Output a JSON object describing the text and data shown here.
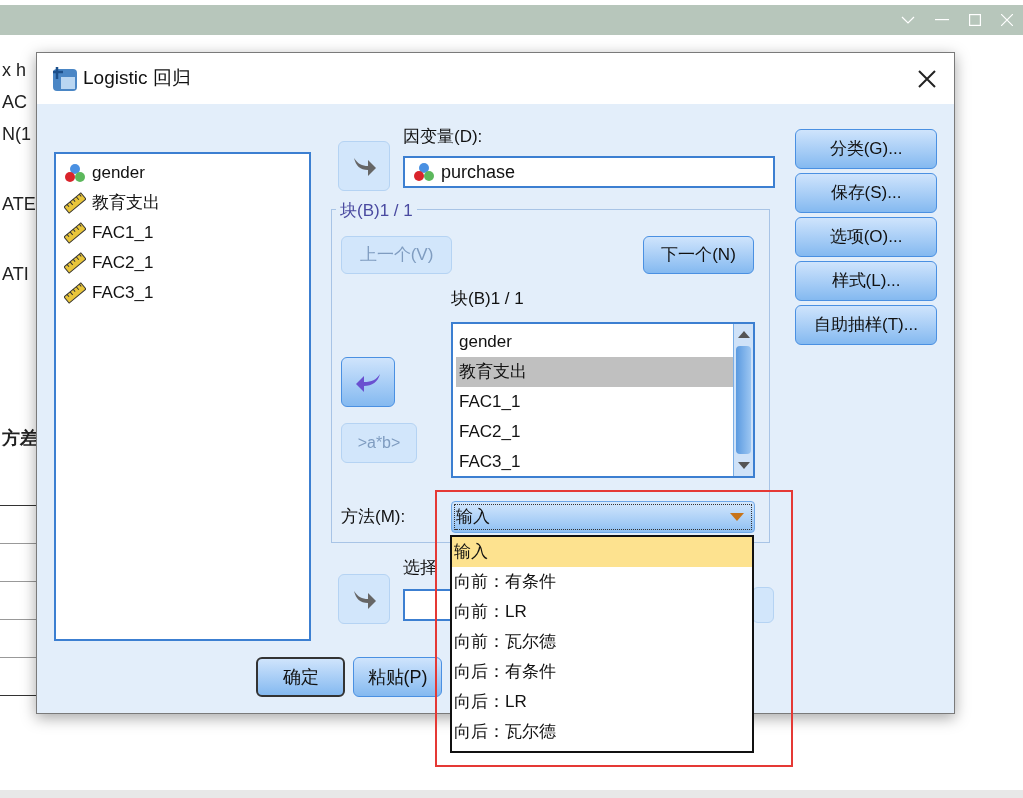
{
  "background_fragments": [
    "x h",
    "AC",
    "N(1",
    "ATE",
    "ATI",
    "方差"
  ],
  "dialog": {
    "title": "Logistic 回归"
  },
  "variables": [
    {
      "name": "gender",
      "kind": "nominal"
    },
    {
      "name": "教育支出",
      "kind": "scale"
    },
    {
      "name": "FAC1_1",
      "kind": "scale"
    },
    {
      "name": "FAC2_1",
      "kind": "scale"
    },
    {
      "name": "FAC3_1",
      "kind": "scale"
    }
  ],
  "dependent": {
    "label": "因变量(D):",
    "value": "purchase",
    "kind": "nominal",
    "arrow": {
      "kind": "add",
      "disabled": true
    }
  },
  "block": {
    "legend": "块(B)1 / 1",
    "previous_button": {
      "label": "上一个(V)",
      "disabled": true
    },
    "next_button": {
      "label": "下一个(N)",
      "disabled": false
    },
    "list_label": "块(B)1 / 1",
    "arrow": {
      "kind": "remove",
      "disabled": false
    },
    "interaction_button": {
      "label": ">a*b>",
      "disabled": true
    },
    "covariates": [
      {
        "name": "gender",
        "selected": false
      },
      {
        "name": "教育支出",
        "selected": true
      },
      {
        "name": "FAC1_1",
        "selected": false
      },
      {
        "name": "FAC2_1",
        "selected": false
      },
      {
        "name": "FAC3_1",
        "selected": false
      }
    ]
  },
  "method": {
    "label": "方法(M):",
    "value": "输入",
    "expanded": true,
    "options": [
      {
        "label": "输入",
        "selected": true
      },
      {
        "label": "向前：有条件",
        "selected": false
      },
      {
        "label": "向前：LR",
        "selected": false
      },
      {
        "label": "向前：瓦尔德",
        "selected": false
      },
      {
        "label": "向后：有条件",
        "selected": false
      },
      {
        "label": "向后：LR",
        "selected": false
      },
      {
        "label": "向后：瓦尔德",
        "selected": false
      }
    ]
  },
  "selection": {
    "label": "选择",
    "arrow": {
      "kind": "add",
      "disabled": true
    }
  },
  "buttons": [
    {
      "label": "确定",
      "default": true
    },
    {
      "label": "粘贴(P)",
      "default": false
    }
  ],
  "side_buttons": [
    "分类(G)...",
    "保存(S)...",
    "选项(O)...",
    "样式(L)...",
    "自助抽样(T)..."
  ]
}
